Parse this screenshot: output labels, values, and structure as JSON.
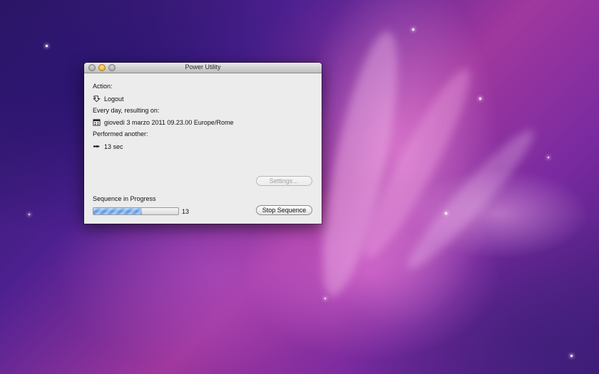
{
  "window": {
    "title": "Power Utility"
  },
  "content": {
    "action_label": "Action:",
    "action_value": "Logout",
    "schedule_label": "Every day, resulting on:",
    "schedule_value": "giovedì 3 marzo 2011 09.23.00 Europe/Rome",
    "performed_label": "Performed another:",
    "performed_value": "13 sec",
    "settings_button": "Settings…",
    "progress_label": "Sequence in Progress",
    "progress_fraction": 0.57,
    "progress_count": "13",
    "stop_button": "Stop Sequence"
  },
  "icons": {
    "action": "logout-arrow-icon",
    "schedule": "calendar-icon",
    "performed": "repeat-arrow-icon"
  },
  "colors": {
    "progress_fill": "#5d99e4",
    "minimize_light": "#e4a01c"
  }
}
